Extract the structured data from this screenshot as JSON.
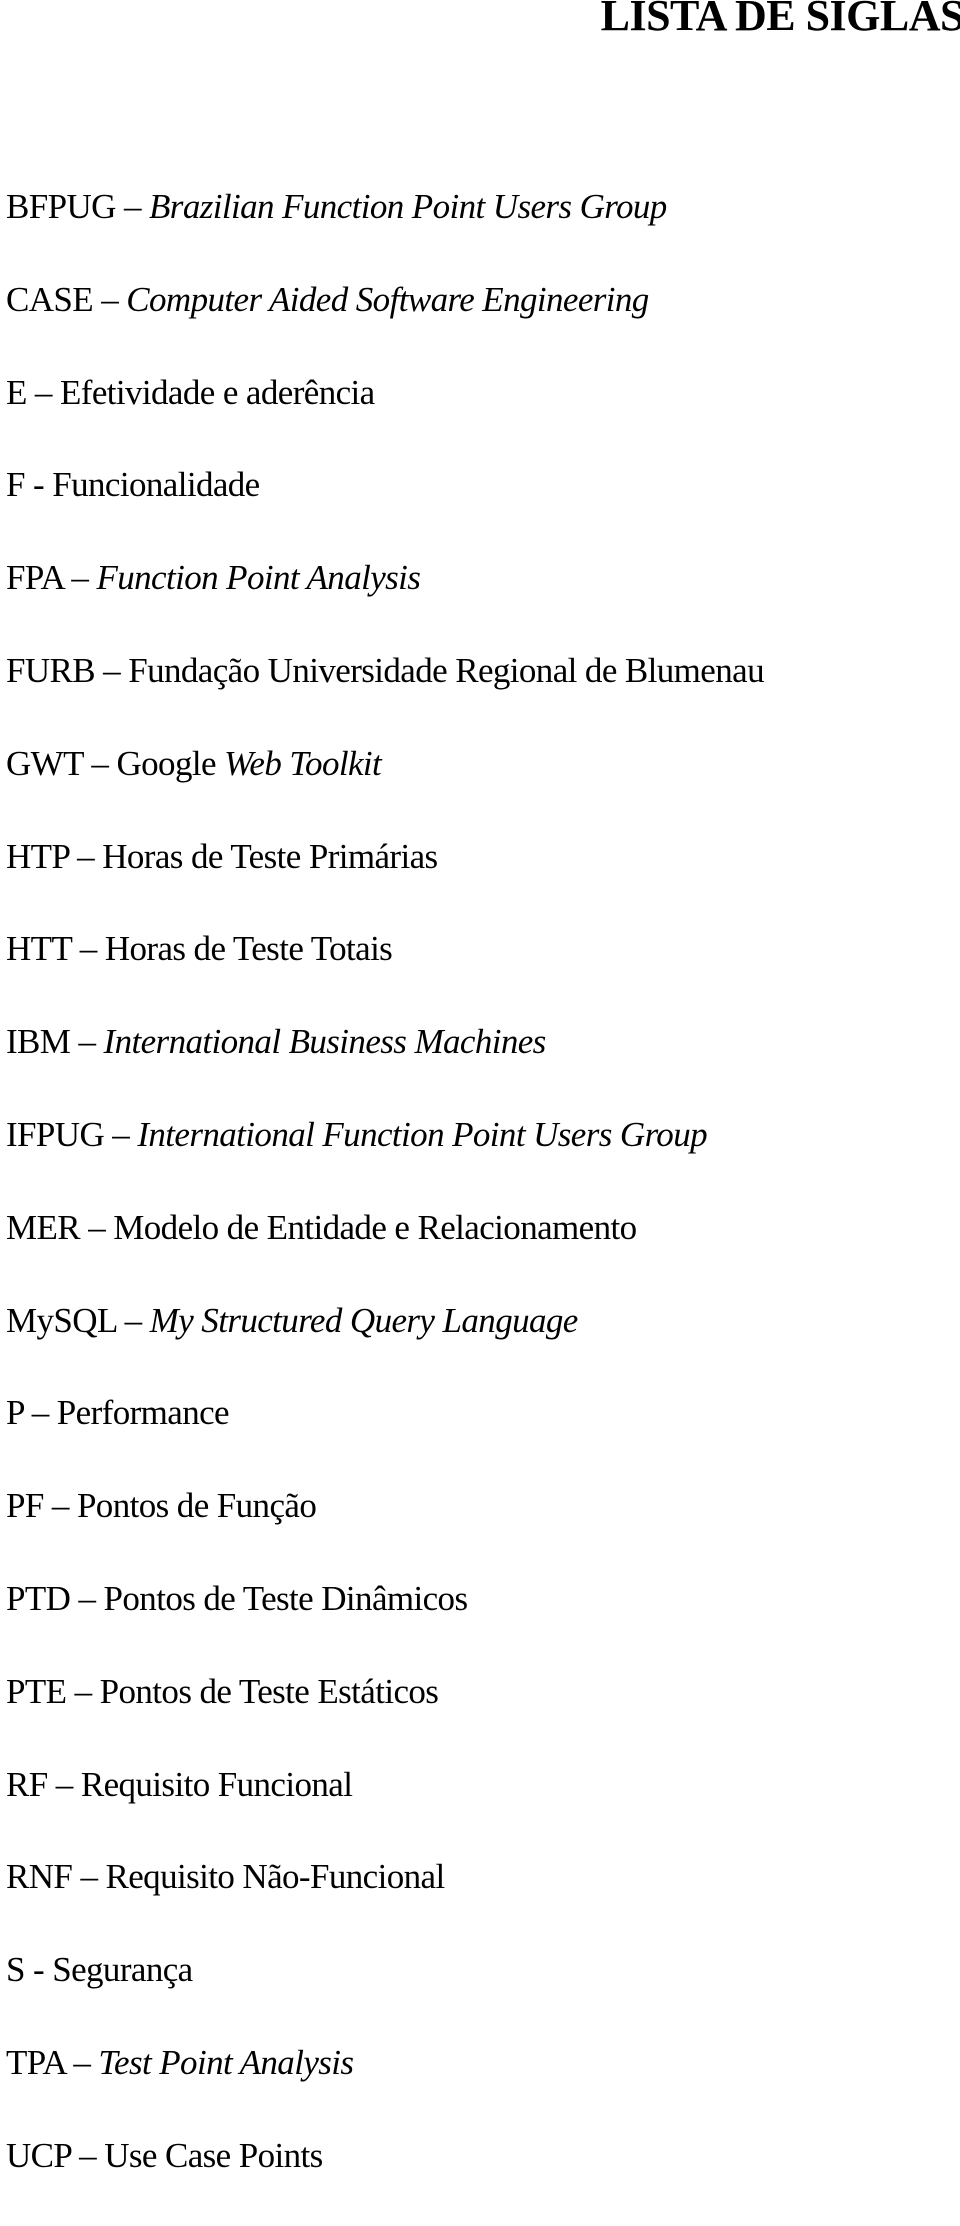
{
  "page": {
    "title": "LISTA DE SIGLAS"
  },
  "acronyms": [
    {
      "term": "BFPUG",
      "sep": " – ",
      "parts": [
        {
          "text": "Brazilian Function Point Users Group",
          "italic": true
        }
      ]
    },
    {
      "term": "CASE",
      "sep": " – ",
      "parts": [
        {
          "text": "Computer Aided Software Engineering",
          "italic": true
        }
      ]
    },
    {
      "term": "E",
      "sep": " – ",
      "parts": [
        {
          "text": "Efetividade e aderência",
          "italic": false
        }
      ]
    },
    {
      "term": "F",
      "sep": " - ",
      "parts": [
        {
          "text": "Funcionalidade",
          "italic": false
        }
      ]
    },
    {
      "term": "FPA",
      "sep": " – ",
      "parts": [
        {
          "text": "Function Point Analysis",
          "italic": true
        }
      ]
    },
    {
      "term": "FURB",
      "sep": " – ",
      "parts": [
        {
          "text": "Fundação Universidade Regional de Blumenau",
          "italic": false
        }
      ]
    },
    {
      "term": "GWT",
      "sep": " – ",
      "parts": [
        {
          "text": "Google ",
          "italic": false
        },
        {
          "text": "Web Toolkit",
          "italic": true
        }
      ]
    },
    {
      "term": "HTP",
      "sep": " – ",
      "parts": [
        {
          "text": "Horas de Teste Primárias",
          "italic": false
        }
      ]
    },
    {
      "term": "HTT",
      "sep": " – ",
      "parts": [
        {
          "text": "Horas de Teste Totais",
          "italic": false
        }
      ]
    },
    {
      "term": "IBM",
      "sep": " – ",
      "parts": [
        {
          "text": "International Business Machines",
          "italic": true
        }
      ]
    },
    {
      "term": "IFPUG",
      "sep": " – ",
      "parts": [
        {
          "text": "International Function Point Users Group",
          "italic": true
        }
      ]
    },
    {
      "term": "MER",
      "sep": " – ",
      "parts": [
        {
          "text": "Modelo de Entidade e Relacionamento",
          "italic": false
        }
      ]
    },
    {
      "term": "MySQL",
      "sep": " – ",
      "parts": [
        {
          "text": "My Structured Query Language",
          "italic": true
        }
      ]
    },
    {
      "term": "P",
      "sep": " – ",
      "parts": [
        {
          "text": "Performance",
          "italic": false
        }
      ]
    },
    {
      "term": "PF",
      "sep": " – ",
      "parts": [
        {
          "text": "Pontos de Função",
          "italic": false
        }
      ]
    },
    {
      "term": "PTD",
      "sep": " – ",
      "parts": [
        {
          "text": "Pontos de Teste Dinâmicos",
          "italic": false
        }
      ]
    },
    {
      "term": "PTE",
      "sep": " – ",
      "parts": [
        {
          "text": "Pontos de Teste Estáticos",
          "italic": false
        }
      ]
    },
    {
      "term": "RF",
      "sep": " – ",
      "parts": [
        {
          "text": "Requisito Funcional",
          "italic": false
        }
      ]
    },
    {
      "term": "RNF",
      "sep": " – ",
      "parts": [
        {
          "text": "Requisito Não-Funcional",
          "italic": false
        }
      ]
    },
    {
      "term": "S",
      "sep": " - ",
      "parts": [
        {
          "text": "Segurança",
          "italic": false
        }
      ]
    },
    {
      "term": "TPA",
      "sep": " – ",
      "parts": [
        {
          "text": "Test Point Analysis",
          "italic": true
        }
      ]
    },
    {
      "term": "UCP",
      "sep": " – ",
      "parts": [
        {
          "text": "Use Case Points",
          "italic": false
        }
      ]
    }
  ]
}
